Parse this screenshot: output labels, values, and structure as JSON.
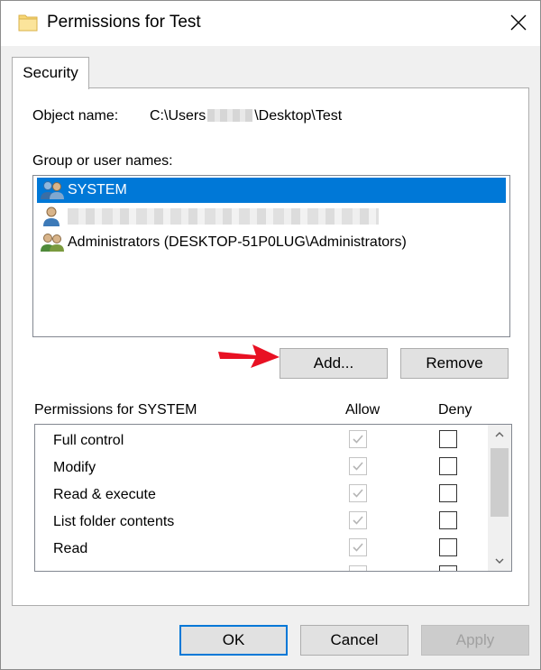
{
  "window": {
    "title": "Permissions for Test"
  },
  "tabs": [
    {
      "label": "Security"
    }
  ],
  "object": {
    "label": "Object name:",
    "path_prefix": "C:\\Users",
    "path_suffix": "\\Desktop\\Test"
  },
  "groups": {
    "label": "Group or user names:",
    "items": [
      {
        "label": "SYSTEM",
        "icon": "group-icon",
        "selected": true
      },
      {
        "label": "",
        "icon": "user-icon",
        "selected": false
      },
      {
        "label": "Administrators (DESKTOP-51P0LUG\\Administrators)",
        "icon": "group-icon",
        "selected": false
      }
    ]
  },
  "buttons": {
    "add": "Add...",
    "remove": "Remove",
    "ok": "OK",
    "cancel": "Cancel",
    "apply": "Apply"
  },
  "permissions": {
    "header": "Permissions for SYSTEM",
    "allow_label": "Allow",
    "deny_label": "Deny",
    "rows": [
      {
        "name": "Full control",
        "allow": true,
        "deny": false
      },
      {
        "name": "Modify",
        "allow": true,
        "deny": false
      },
      {
        "name": "Read & execute",
        "allow": true,
        "deny": false
      },
      {
        "name": "List folder contents",
        "allow": true,
        "deny": false
      },
      {
        "name": "Read",
        "allow": true,
        "deny": false
      },
      {
        "name": "",
        "allow": true,
        "deny": false
      }
    ]
  },
  "colors": {
    "selection": "#0078d7",
    "arrow": "#e81123",
    "folder": "#f8d775"
  }
}
